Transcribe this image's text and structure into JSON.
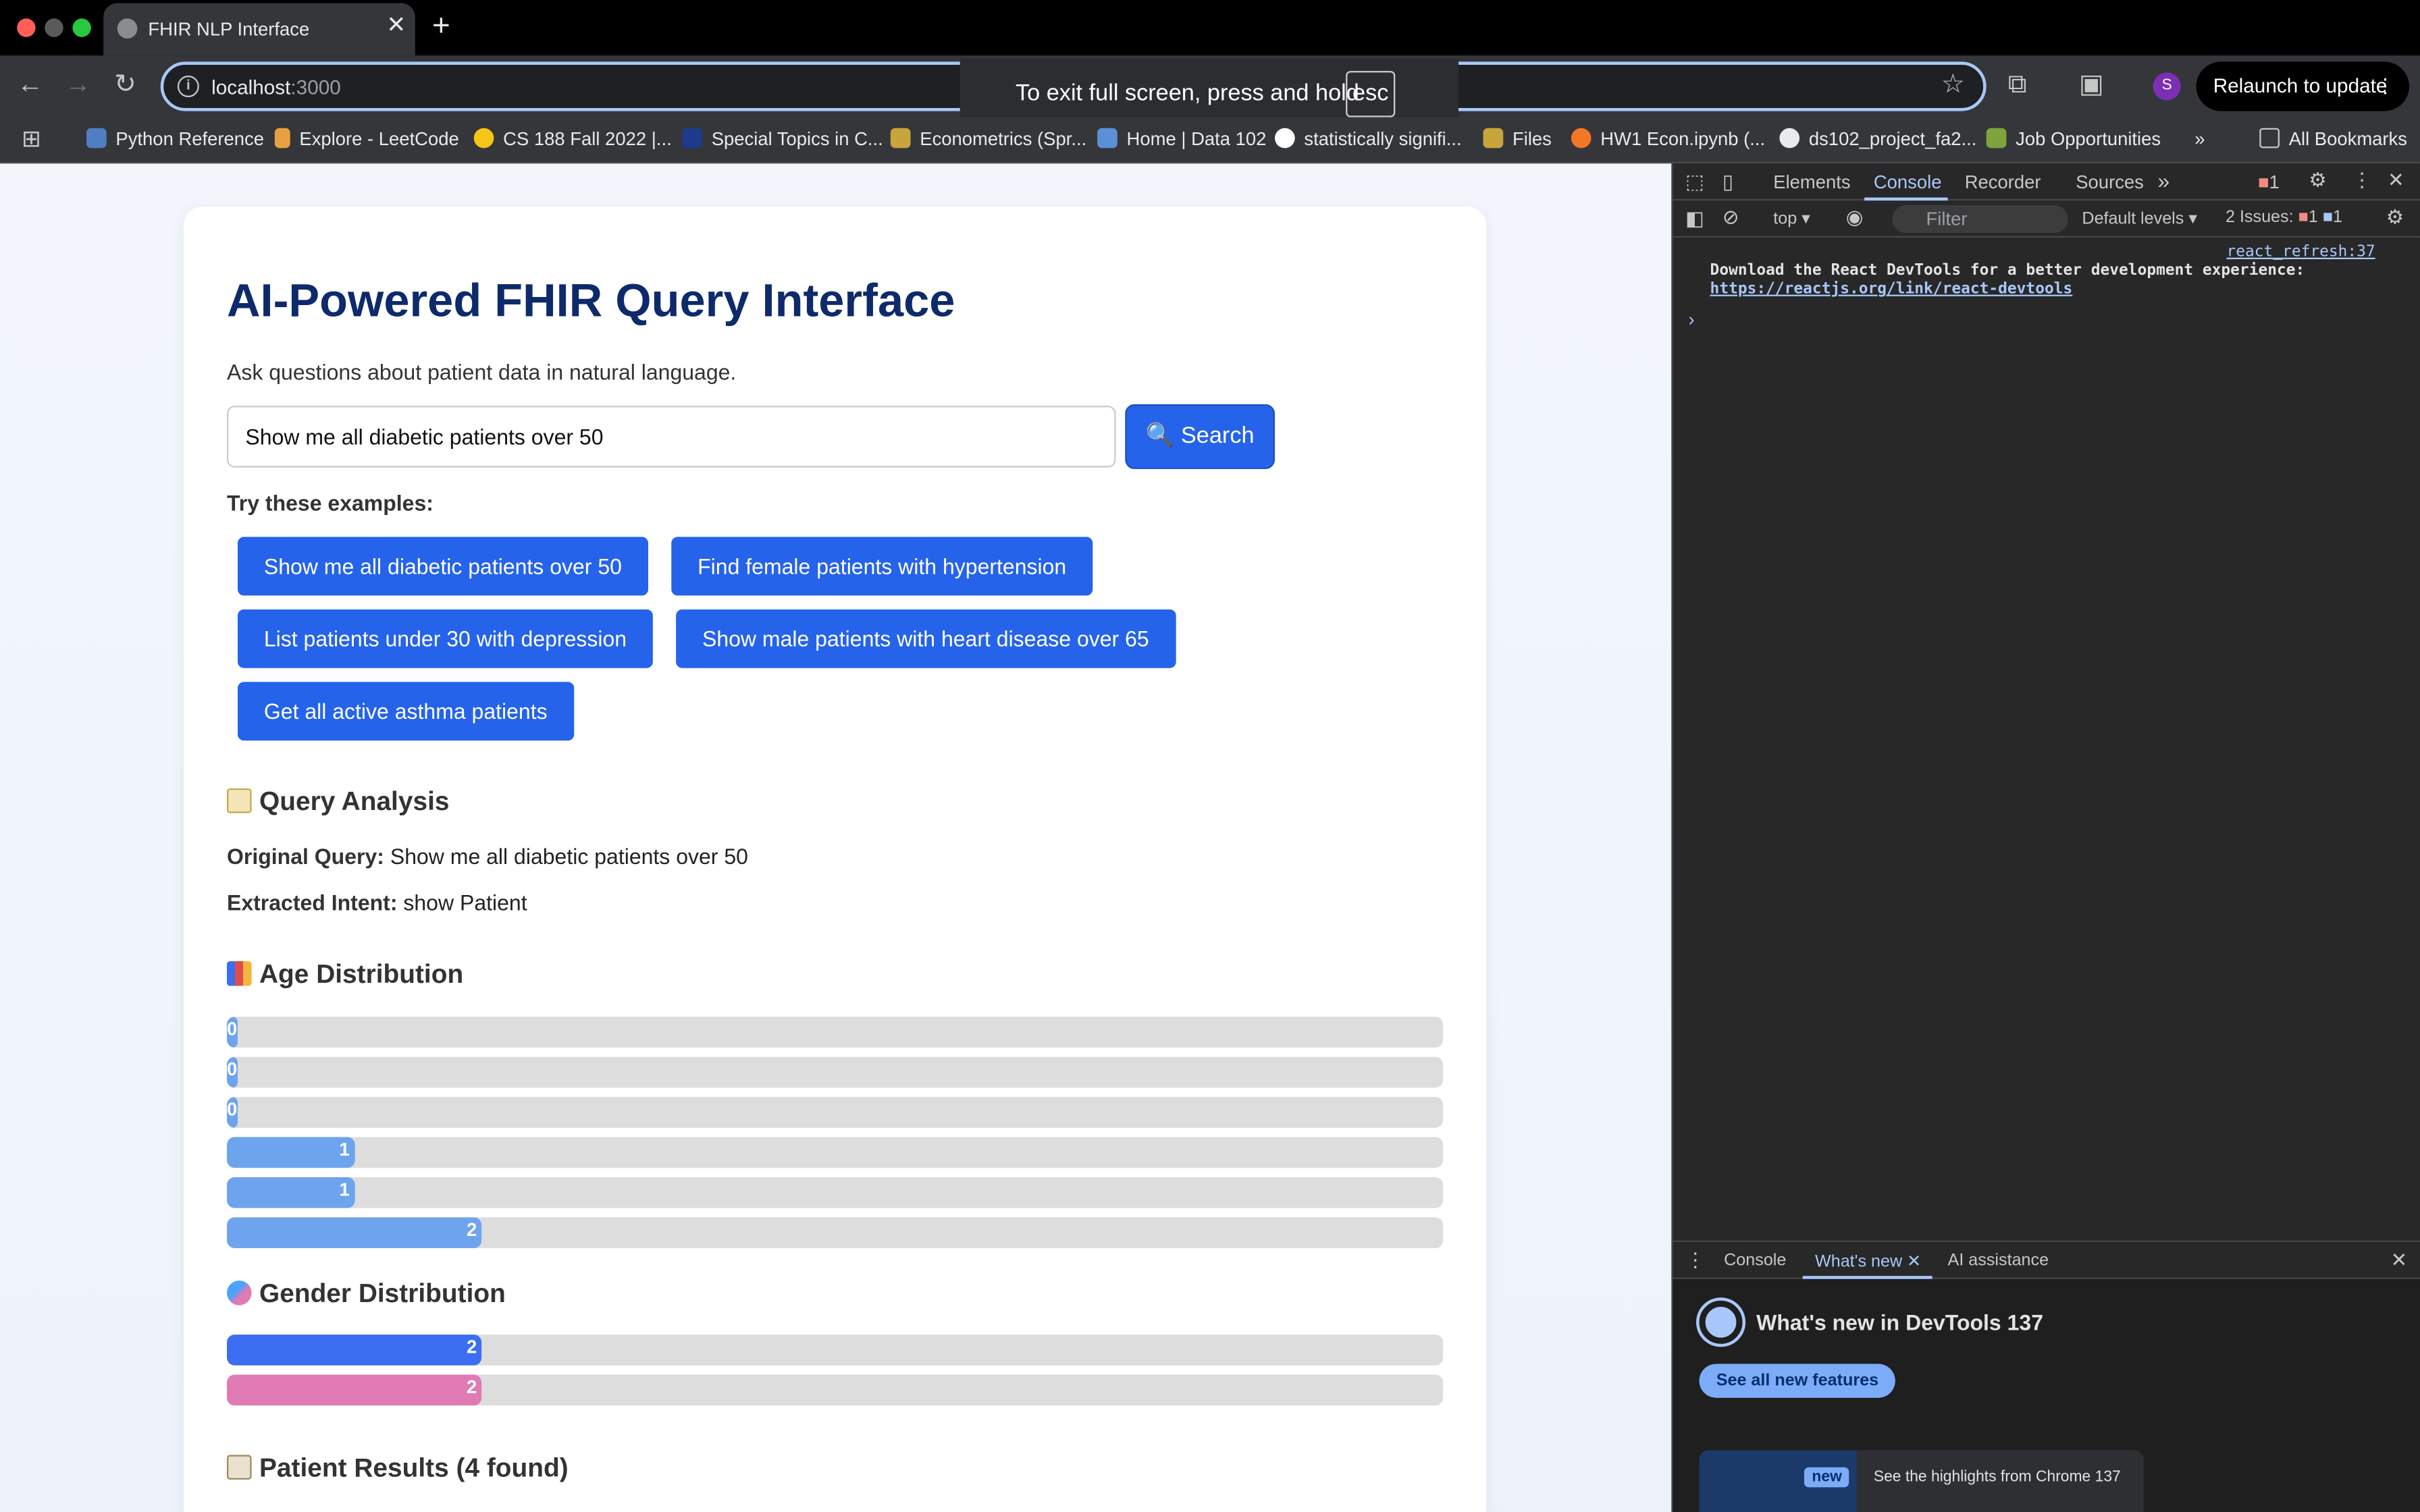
{
  "browser": {
    "tab_title": "FHIR NLP Interface",
    "tab_close": "✕",
    "new_tab": "+",
    "url_host": "localhost",
    "url_port": ":3000",
    "profile_initial": "S",
    "relaunch_label": "Relaunch to update",
    "fullscreen_toast": "To exit full screen, press and hold",
    "fullscreen_key": "esc"
  },
  "bookmarks": [
    {
      "label": "Python Reference"
    },
    {
      "label": "Explore - LeetCode"
    },
    {
      "label": "CS 188 Fall 2022 |..."
    },
    {
      "label": "Special Topics in C..."
    },
    {
      "label": "Econometrics (Spr..."
    },
    {
      "label": "Home | Data 102"
    },
    {
      "label": "statistically signifi..."
    },
    {
      "label": "Files"
    },
    {
      "label": "HW1 Econ.ipynb (..."
    },
    {
      "label": "ds102_project_fa2..."
    },
    {
      "label": "Job Opportunities"
    },
    {
      "label": "All Bookmarks"
    }
  ],
  "app": {
    "title": "AI-Powered FHIR Query Interface",
    "subtitle": "Ask questions about patient data in natural language.",
    "search_value": "Show me all diabetic patients over 50",
    "search_button": "🔍 Search",
    "examples_title": "Try these examples:",
    "examples": [
      "Show me all diabetic patients over 50",
      "Find female patients with hypertension",
      "List patients under 30 with depression",
      "Show male patients with heart disease over 65",
      "Get all active asthma patients"
    ],
    "query_analysis": {
      "heading": "Query Analysis",
      "original_label": "Original Query:",
      "original_value": "Show me all diabetic patients over 50",
      "intent_label": "Extracted Intent:",
      "intent_value": "show Patient"
    },
    "age_distribution": {
      "heading": "Age Distribution",
      "bars": [
        {
          "value": "0",
          "fraction": 0.0
        },
        {
          "value": "0",
          "fraction": 0.0
        },
        {
          "value": "0",
          "fraction": 0.0
        },
        {
          "value": "1",
          "fraction": 0.5
        },
        {
          "value": "1",
          "fraction": 0.5
        },
        {
          "value": "2",
          "fraction": 1.0
        }
      ]
    },
    "gender_distribution": {
      "heading": "Gender Distribution",
      "bars": [
        {
          "value": "2",
          "fraction": 1.0,
          "color": "#3b6ef0"
        },
        {
          "value": "2",
          "fraction": 1.0,
          "color": "#e07ab4"
        }
      ]
    },
    "results_heading": "Patient Results (4 found)"
  },
  "devtools": {
    "tabs": [
      "Elements",
      "Console",
      "Recorder",
      "Sources"
    ],
    "more_tabs": "»",
    "error_count": "1",
    "context": "top ▾",
    "filter_placeholder": "Filter",
    "levels": "Default levels ▾",
    "issues_label": "2 Issues:",
    "issues_errors": "1",
    "issues_info": "1",
    "console_source": "react_refresh:37",
    "console_message": "Download the React DevTools for a better development experience:",
    "console_link": "https://reactjs.org/link/react-devtools",
    "console_prompt": "›",
    "drawer_tabs": [
      "Console",
      "What's new",
      "AI assistance"
    ],
    "whats_new_title": "What's new in DevTools 137",
    "see_all_button": "See all new features",
    "new_badge": "new",
    "highlight_text": "See the highlights from Chrome 137"
  }
}
